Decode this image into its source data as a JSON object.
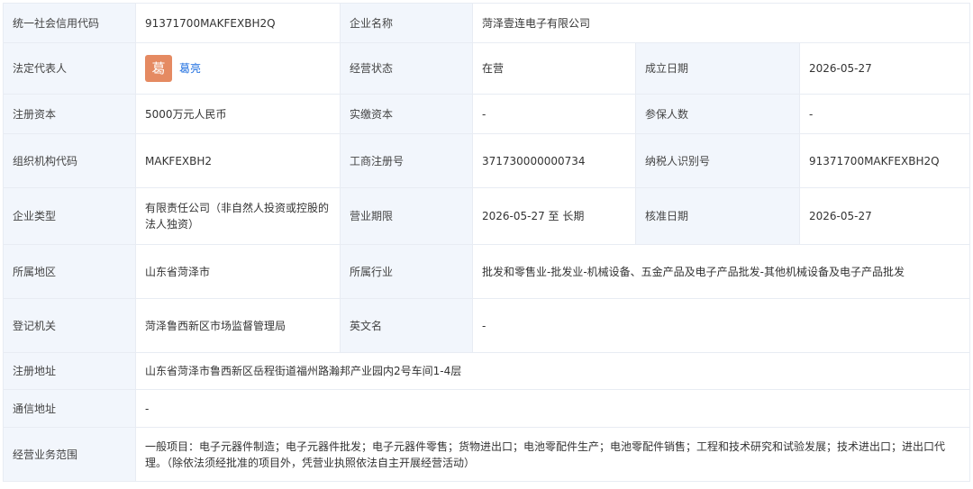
{
  "row1": {
    "credit_code_label": "统一社会信用代码",
    "credit_code": "91371700MAKFEXBH2Q",
    "company_name_label": "企业名称",
    "company_name": "菏泽壹连电子有限公司"
  },
  "row2": {
    "legal_rep_label": "法定代表人",
    "legal_rep_avatar": "葛",
    "legal_rep_name": "葛亮",
    "status_label": "经营状态",
    "status": "在营",
    "founded_label": "成立日期",
    "founded": "2026-05-27"
  },
  "row3": {
    "reg_capital_label": "注册资本",
    "reg_capital": "5000万元人民币",
    "paid_capital_label": "实缴资本",
    "paid_capital": "-",
    "insured_label": "参保人数",
    "insured": "-"
  },
  "row4": {
    "org_code_label": "组织机构代码",
    "org_code": "MAKFEXBH2",
    "biz_reg_label": "工商注册号",
    "biz_reg": "371730000000734",
    "taxpayer_label": "纳税人识别号",
    "taxpayer": "91371700MAKFEXBH2Q"
  },
  "row5": {
    "type_label": "企业类型",
    "type": "有限责任公司（非自然人投资或控股的法人独资）",
    "term_label": "营业期限",
    "term": "2026-05-27 至 长期",
    "approval_label": "核准日期",
    "approval": "2026-05-27"
  },
  "row6": {
    "region_label": "所属地区",
    "region": "山东省菏泽市",
    "industry_label": "所属行业",
    "industry": "批发和零售业-批发业-机械设备、五金产品及电子产品批发-其他机械设备及电子产品批发"
  },
  "row7": {
    "authority_label": "登记机关",
    "authority": "菏泽鲁西新区市场监督管理局",
    "english_label": "英文名",
    "english": "-"
  },
  "row8": {
    "address_label": "注册地址",
    "address": "山东省菏泽市鲁西新区岳程街道福州路瀚邦产业园内2号车间1-4层"
  },
  "row9": {
    "mail_label": "通信地址",
    "mail": "-"
  },
  "row10": {
    "scope_label": "经营业务范围",
    "scope": "一般项目：电子元器件制造；电子元器件批发；电子元器件零售；货物进出口；电池零配件生产；电池零配件销售；工程和技术研究和试验发展；技术进出口；进出口代理。（除依法须经批准的项目外，凭营业执照依法自主开展经营活动）"
  },
  "colors": {
    "label_bg": "#f2f6fc",
    "border": "#e8ecf3",
    "link": "#1f6fe0",
    "avatar_bg": "#e58a62"
  }
}
